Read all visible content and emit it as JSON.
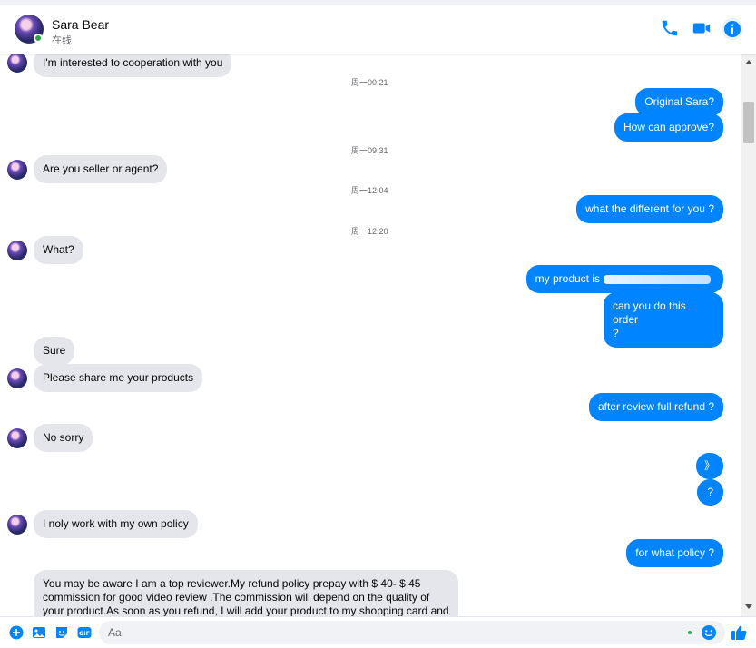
{
  "header": {
    "name": "Sara Bear",
    "status": "在线",
    "icons": [
      "phone-icon",
      "video-icon",
      "info-icon"
    ],
    "accent": "#0084ff"
  },
  "messages": [
    {
      "dir": "in",
      "text": "I'm interested to cooperation with you",
      "avatar": true
    },
    {
      "dir": "ts",
      "text": "周一00:21"
    },
    {
      "dir": "out",
      "text": "Original Sara?"
    },
    {
      "dir": "out",
      "text": "How can approve?"
    },
    {
      "dir": "ts",
      "text": "周一09:31"
    },
    {
      "dir": "in",
      "text": "Are you seller or agent?",
      "avatar": true
    },
    {
      "dir": "ts",
      "text": "周一12:04"
    },
    {
      "dir": "out",
      "text": "what the different for you ?"
    },
    {
      "dir": "ts",
      "text": "周一12:20"
    },
    {
      "dir": "in",
      "text": "What?",
      "avatar": true
    },
    {
      "dir": "out",
      "text": "my product is"
    },
    {
      "dir": "out",
      "text": "can you do this order",
      "text2": "?"
    },
    {
      "dir": "in",
      "text": "Sure",
      "avatar": false
    },
    {
      "dir": "in",
      "text": "Please share me your products",
      "avatar": true
    },
    {
      "dir": "out",
      "text": "after review full refund ?"
    },
    {
      "dir": "in",
      "text": "No sorry",
      "avatar": true
    },
    {
      "dir": "out",
      "text": "》"
    },
    {
      "dir": "out",
      "text": "?"
    },
    {
      "dir": "in",
      "text": "I noly work with my own policy",
      "avatar": true
    },
    {
      "dir": "out",
      "text": "for what policy ?"
    },
    {
      "dir": "in",
      "text": "You may be aware I am a top reviewer.My refund policy prepay with $ 40- $ 45",
      "text2": "commission for good video review .The commission will depend on the quality of",
      "text3": "your product.As soon as you refund, I will add your product to my shopping card and"
    }
  ],
  "composer": {
    "placeholder": "Aa",
    "icons": [
      "plus-icon",
      "image-icon",
      "sticker-icon",
      "gif-icon",
      "emoji-icon",
      "like-icon"
    ]
  }
}
